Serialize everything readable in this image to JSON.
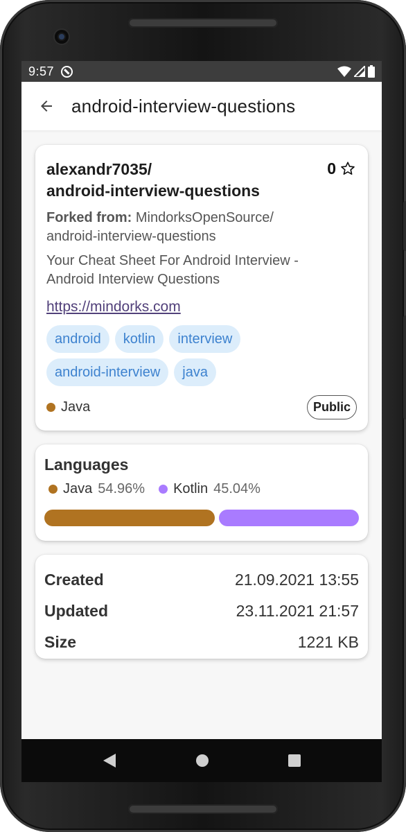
{
  "status_bar": {
    "time": "9:57",
    "icons": [
      "do-not-disturb-icon",
      "wifi-icon",
      "signal-icon",
      "battery-icon"
    ]
  },
  "app_bar": {
    "back_icon": "arrow-back-icon",
    "title": "android-interview-questions"
  },
  "repo": {
    "name_line1": "alexandr7035/",
    "name_line2": "android-interview-questions",
    "stars": "0",
    "star_icon": "star-outline-icon",
    "forked_label": "Forked from:",
    "forked_value_line1": " MindorksOpenSource/",
    "forked_value_line2": "android-interview-questions",
    "description_line1": "Your Cheat Sheet For Android Interview -",
    "description_line2": "Android Interview Questions",
    "homepage": "https://mindorks.com",
    "topics": [
      "android",
      "kotlin",
      "interview",
      "android-interview",
      "java"
    ],
    "primary_language": "Java",
    "visibility": "Public"
  },
  "languages": {
    "title": "Languages",
    "items": [
      {
        "name": "Java",
        "percent": "54.96%",
        "fraction": 0.5496,
        "color": "#b07321"
      },
      {
        "name": "Kotlin",
        "percent": "45.04%",
        "fraction": 0.4504,
        "color": "#a97bff"
      }
    ]
  },
  "info": {
    "rows": [
      {
        "label": "Created",
        "value": "21.09.2021 13:55"
      },
      {
        "label": "Updated",
        "value": "23.11.2021 21:57"
      },
      {
        "label": "Size",
        "value": "1221 KB"
      }
    ]
  },
  "nav_bar": {
    "icons": [
      "nav-back-icon",
      "nav-home-icon",
      "nav-recents-icon"
    ]
  },
  "colors": {
    "link": "#51407a",
    "chip_bg": "#dcedfb",
    "chip_text": "#3d82cf",
    "java": "#b07321",
    "kotlin": "#a97bff"
  }
}
